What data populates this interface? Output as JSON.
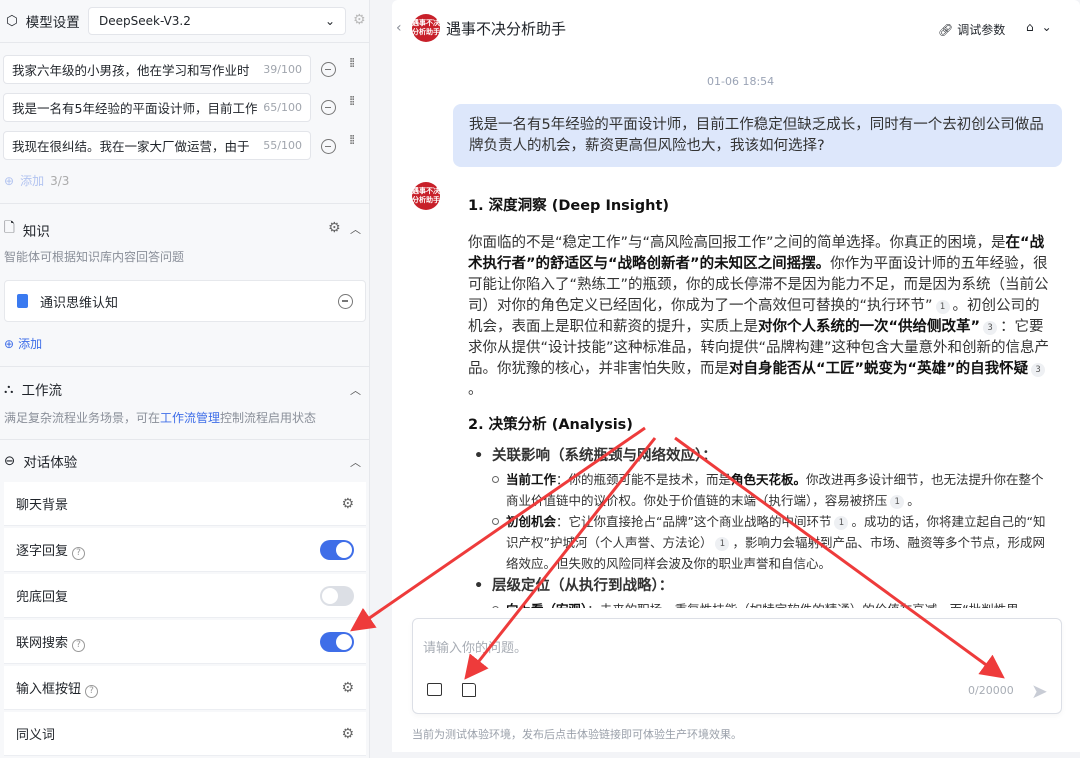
{
  "left": {
    "model_label": "模型设置",
    "model_value": "DeepSeek-V3.2",
    "prompts": [
      {
        "text": "我家六年级的小男孩，他在学习和写作业时",
        "count": "39/100"
      },
      {
        "text": "我是一名有5年经验的平面设计师，目前工作",
        "count": "65/100"
      },
      {
        "text": "我现在很纠结。我在一家大厂做运营，由于",
        "count": "55/100"
      }
    ],
    "add_label": "添加",
    "add_count": "3/3",
    "knowledge": {
      "title": "知识",
      "desc": "智能体可根据知识库内容回答问题",
      "item": "通识思维认知",
      "add": "添加"
    },
    "workflow": {
      "title": "工作流",
      "desc_pre": "满足复杂流程业务场景，可在",
      "desc_link": "工作流管理",
      "desc_post": "控制流程启用状态"
    },
    "chat": {
      "title": "对话体验",
      "items": [
        {
          "label": "聊天背景",
          "type": "gear"
        },
        {
          "label": "逐字回复",
          "help": "?",
          "type": "toggle",
          "on": true
        },
        {
          "label": "兜底回复",
          "type": "toggle",
          "on": false
        },
        {
          "label": "联网搜索",
          "help": "?",
          "type": "toggle",
          "on": true
        },
        {
          "label": "输入框按钮",
          "help": "?",
          "type": "gear"
        },
        {
          "label": "同义词",
          "type": "gear"
        }
      ]
    }
  },
  "header": {
    "title": "遇事不决分析助手",
    "avatar_text": "遇事不决分析助手",
    "debug": "调试参数"
  },
  "chat": {
    "time": "01-06 18:54",
    "user_msg": "我是一名有5年经验的平面设计师，目前工作稳定但缺乏成长，同时有一个去初创公司做品牌负责人的机会，薪资更高但风险也大，我该如何选择?",
    "h1": "1. 深度洞察 (Deep Insight)",
    "p1": [
      {
        "t": "你面临的不是“稳定工作”与“高风险高回报工作”之间的简单选择。你真正的困境，是"
      },
      {
        "t": "在“战术执行者”的舒适区与“战略创新者”的未知区之间摇摆。",
        "b": true
      },
      {
        "t": "你作为平面设计师的五年经验，很可能让你陷入了“熟练工”的瓶颈，你的成长停滞不是因为能力不足，而是因为系统（当前公司）对你的角色定义已经固化，你成为了一个高效但可替换的“执行环节”"
      },
      {
        "c": "1"
      },
      {
        "t": "。初创公司的机会，表面上是职位和薪资的提升，实质上是"
      },
      {
        "t": "对你个人系统的一次“供给侧改革”",
        "b": true
      },
      {
        "c": "3"
      },
      {
        "t": "：它要求你从提供“设计技能”这种标准品，转向提供“品牌构建”这种包含大量意外和创新的信息产品。你犹豫的核心，并非害怕失败，而是"
      },
      {
        "t": "对自身能否从“工匠”蜕变为“英雄”的自我怀疑",
        "b": true
      },
      {
        "c": "3"
      },
      {
        "t": "。"
      }
    ],
    "h2": "2. 决策分析 (Analysis)",
    "b1": "关联影响（系统瓶颈与网络效应）：",
    "b1a": [
      {
        "t": "当前工作",
        "b": true
      },
      {
        "t": "：你的瓶颈可能不是技术，而是"
      },
      {
        "t": "角色天花板。",
        "b": true
      },
      {
        "t": "你改进再多设计细节，也无法提升你在整个商业价值链中的议价权。你处于价值链的末端（执行端），容易被挤压"
      },
      {
        "c": "1"
      },
      {
        "t": "。"
      }
    ],
    "b1b": [
      {
        "t": "初创机会",
        "b": true
      },
      {
        "t": "：它让你直接抢占“品牌”这个商业战略的中间环节"
      },
      {
        "c": "1"
      },
      {
        "t": "。成功的话，你将建立起自己的“知识产权”护城河（个人声誉、方法论）"
      },
      {
        "c": "1"
      },
      {
        "t": "，影响力会辐射到产品、市场、融资等多个节点，形成网络效应。但失败的风险同样会波及你的职业声誉和自信心。"
      }
    ],
    "b2": "层级定位（从执行到战略）：",
    "b2a": [
      {
        "t": "向上看（宏观）",
        "b": true
      },
      {
        "t": "：未来的职场，重复性技能（如特定软件的精通）的价值在衰减，而“批判性思"
      }
    ]
  },
  "input": {
    "placeholder": "请输入你的问题。",
    "count": "0/20000",
    "footer": "当前为测试体验环境，发布后点击体验链接即可体验生产环境效果。"
  },
  "colors": {
    "accent": "#3f6ee8",
    "user_bubble": "#dde7fb",
    "arrow": "#ee3b3b"
  }
}
